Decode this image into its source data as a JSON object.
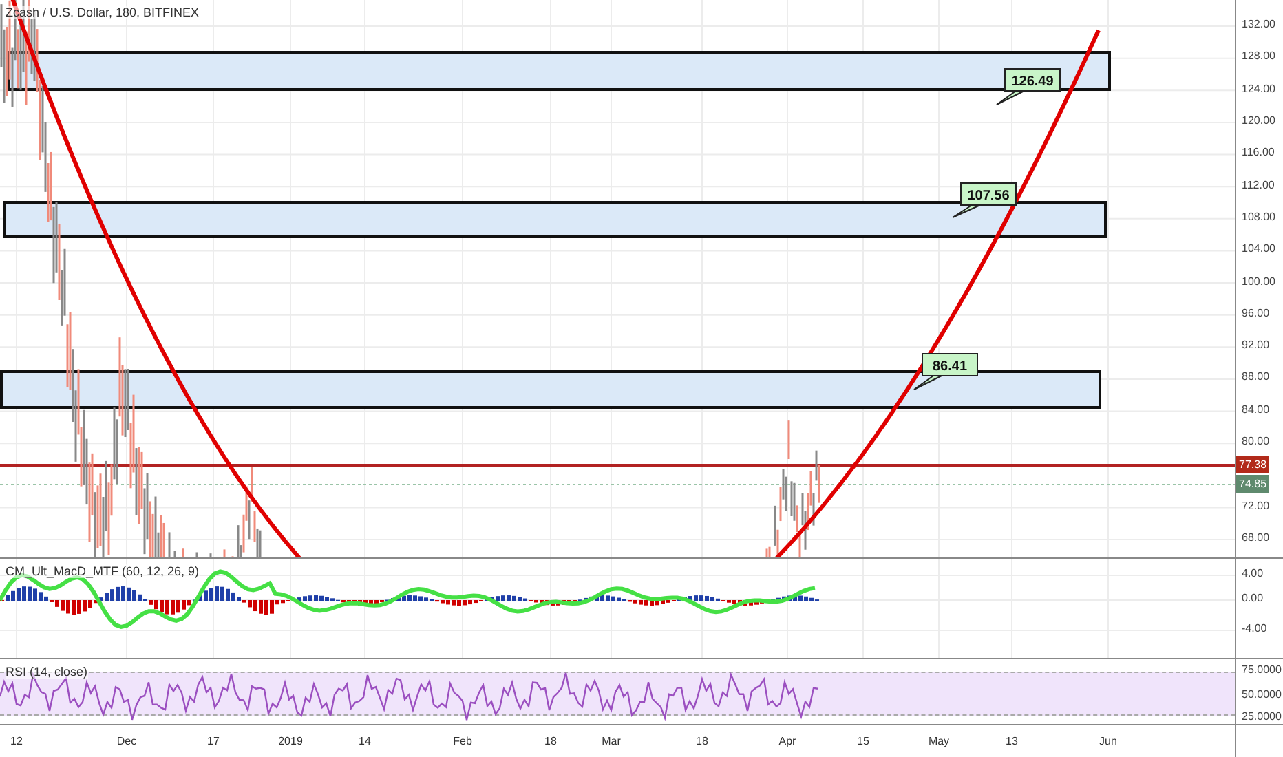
{
  "header": {
    "title": "Zcash / U.S. Dollar, 180, BITFINEX"
  },
  "price_pane": {
    "ticks": [
      "132.00",
      "128.00",
      "124.00",
      "120.00",
      "116.00",
      "112.00",
      "108.00",
      "104.00",
      "100.00",
      "96.00",
      "92.00",
      "88.00",
      "84.00",
      "80.00",
      "72.00",
      "68.00"
    ],
    "marks": [
      {
        "label": "77.38",
        "kind": "level"
      },
      {
        "label": "74.85",
        "kind": "last"
      }
    ],
    "zones": [
      {
        "label": "126.49"
      },
      {
        "label": "107.56"
      },
      {
        "label": "86.41"
      }
    ]
  },
  "macd_pane": {
    "title": "CM_Ult_MacD_MTF (60, 12, 26, 9)",
    "ticks": [
      "4.00",
      "0.00",
      "-4.00"
    ]
  },
  "rsi_pane": {
    "title": "RSI (14, close)",
    "ticks": [
      "75.0000",
      "50.0000",
      "25.0000"
    ]
  },
  "time_axis": {
    "labels": [
      "12",
      "Dec",
      "17",
      "2019",
      "14",
      "Feb",
      "18",
      "Mar",
      "18",
      "Apr",
      "15",
      "May",
      "13",
      "Jun"
    ]
  }
}
